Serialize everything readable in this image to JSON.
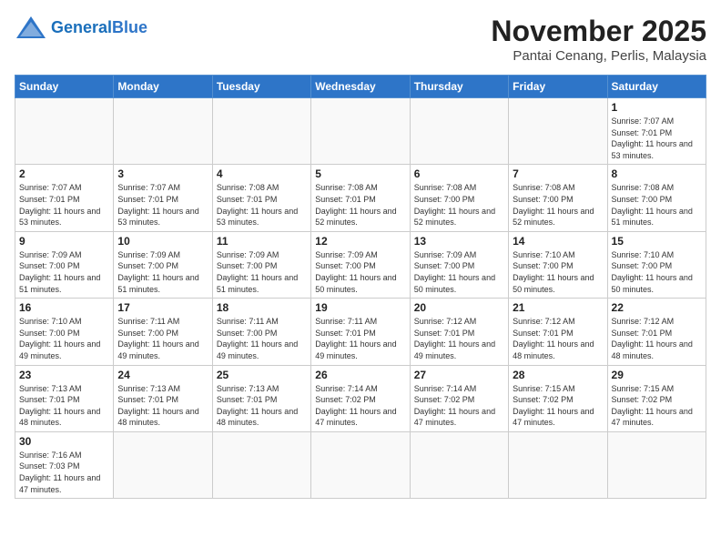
{
  "header": {
    "logo_general": "General",
    "logo_blue": "Blue",
    "month_title": "November 2025",
    "location": "Pantai Cenang, Perlis, Malaysia"
  },
  "weekdays": [
    "Sunday",
    "Monday",
    "Tuesday",
    "Wednesday",
    "Thursday",
    "Friday",
    "Saturday"
  ],
  "weeks": [
    [
      {
        "day": "",
        "sunrise": "",
        "sunset": "",
        "daylight": ""
      },
      {
        "day": "",
        "sunrise": "",
        "sunset": "",
        "daylight": ""
      },
      {
        "day": "",
        "sunrise": "",
        "sunset": "",
        "daylight": ""
      },
      {
        "day": "",
        "sunrise": "",
        "sunset": "",
        "daylight": ""
      },
      {
        "day": "",
        "sunrise": "",
        "sunset": "",
        "daylight": ""
      },
      {
        "day": "",
        "sunrise": "",
        "sunset": "",
        "daylight": ""
      },
      {
        "day": "1",
        "sunrise": "Sunrise: 7:07 AM",
        "sunset": "Sunset: 7:01 PM",
        "daylight": "Daylight: 11 hours and 53 minutes."
      }
    ],
    [
      {
        "day": "2",
        "sunrise": "Sunrise: 7:07 AM",
        "sunset": "Sunset: 7:01 PM",
        "daylight": "Daylight: 11 hours and 53 minutes."
      },
      {
        "day": "3",
        "sunrise": "Sunrise: 7:07 AM",
        "sunset": "Sunset: 7:01 PM",
        "daylight": "Daylight: 11 hours and 53 minutes."
      },
      {
        "day": "4",
        "sunrise": "Sunrise: 7:08 AM",
        "sunset": "Sunset: 7:01 PM",
        "daylight": "Daylight: 11 hours and 53 minutes."
      },
      {
        "day": "5",
        "sunrise": "Sunrise: 7:08 AM",
        "sunset": "Sunset: 7:01 PM",
        "daylight": "Daylight: 11 hours and 52 minutes."
      },
      {
        "day": "6",
        "sunrise": "Sunrise: 7:08 AM",
        "sunset": "Sunset: 7:00 PM",
        "daylight": "Daylight: 11 hours and 52 minutes."
      },
      {
        "day": "7",
        "sunrise": "Sunrise: 7:08 AM",
        "sunset": "Sunset: 7:00 PM",
        "daylight": "Daylight: 11 hours and 52 minutes."
      },
      {
        "day": "8",
        "sunrise": "Sunrise: 7:08 AM",
        "sunset": "Sunset: 7:00 PM",
        "daylight": "Daylight: 11 hours and 51 minutes."
      }
    ],
    [
      {
        "day": "9",
        "sunrise": "Sunrise: 7:09 AM",
        "sunset": "Sunset: 7:00 PM",
        "daylight": "Daylight: 11 hours and 51 minutes."
      },
      {
        "day": "10",
        "sunrise": "Sunrise: 7:09 AM",
        "sunset": "Sunset: 7:00 PM",
        "daylight": "Daylight: 11 hours and 51 minutes."
      },
      {
        "day": "11",
        "sunrise": "Sunrise: 7:09 AM",
        "sunset": "Sunset: 7:00 PM",
        "daylight": "Daylight: 11 hours and 51 minutes."
      },
      {
        "day": "12",
        "sunrise": "Sunrise: 7:09 AM",
        "sunset": "Sunset: 7:00 PM",
        "daylight": "Daylight: 11 hours and 50 minutes."
      },
      {
        "day": "13",
        "sunrise": "Sunrise: 7:09 AM",
        "sunset": "Sunset: 7:00 PM",
        "daylight": "Daylight: 11 hours and 50 minutes."
      },
      {
        "day": "14",
        "sunrise": "Sunrise: 7:10 AM",
        "sunset": "Sunset: 7:00 PM",
        "daylight": "Daylight: 11 hours and 50 minutes."
      },
      {
        "day": "15",
        "sunrise": "Sunrise: 7:10 AM",
        "sunset": "Sunset: 7:00 PM",
        "daylight": "Daylight: 11 hours and 50 minutes."
      }
    ],
    [
      {
        "day": "16",
        "sunrise": "Sunrise: 7:10 AM",
        "sunset": "Sunset: 7:00 PM",
        "daylight": "Daylight: 11 hours and 49 minutes."
      },
      {
        "day": "17",
        "sunrise": "Sunrise: 7:11 AM",
        "sunset": "Sunset: 7:00 PM",
        "daylight": "Daylight: 11 hours and 49 minutes."
      },
      {
        "day": "18",
        "sunrise": "Sunrise: 7:11 AM",
        "sunset": "Sunset: 7:00 PM",
        "daylight": "Daylight: 11 hours and 49 minutes."
      },
      {
        "day": "19",
        "sunrise": "Sunrise: 7:11 AM",
        "sunset": "Sunset: 7:01 PM",
        "daylight": "Daylight: 11 hours and 49 minutes."
      },
      {
        "day": "20",
        "sunrise": "Sunrise: 7:12 AM",
        "sunset": "Sunset: 7:01 PM",
        "daylight": "Daylight: 11 hours and 49 minutes."
      },
      {
        "day": "21",
        "sunrise": "Sunrise: 7:12 AM",
        "sunset": "Sunset: 7:01 PM",
        "daylight": "Daylight: 11 hours and 48 minutes."
      },
      {
        "day": "22",
        "sunrise": "Sunrise: 7:12 AM",
        "sunset": "Sunset: 7:01 PM",
        "daylight": "Daylight: 11 hours and 48 minutes."
      }
    ],
    [
      {
        "day": "23",
        "sunrise": "Sunrise: 7:13 AM",
        "sunset": "Sunset: 7:01 PM",
        "daylight": "Daylight: 11 hours and 48 minutes."
      },
      {
        "day": "24",
        "sunrise": "Sunrise: 7:13 AM",
        "sunset": "Sunset: 7:01 PM",
        "daylight": "Daylight: 11 hours and 48 minutes."
      },
      {
        "day": "25",
        "sunrise": "Sunrise: 7:13 AM",
        "sunset": "Sunset: 7:01 PM",
        "daylight": "Daylight: 11 hours and 48 minutes."
      },
      {
        "day": "26",
        "sunrise": "Sunrise: 7:14 AM",
        "sunset": "Sunset: 7:02 PM",
        "daylight": "Daylight: 11 hours and 47 minutes."
      },
      {
        "day": "27",
        "sunrise": "Sunrise: 7:14 AM",
        "sunset": "Sunset: 7:02 PM",
        "daylight": "Daylight: 11 hours and 47 minutes."
      },
      {
        "day": "28",
        "sunrise": "Sunrise: 7:15 AM",
        "sunset": "Sunset: 7:02 PM",
        "daylight": "Daylight: 11 hours and 47 minutes."
      },
      {
        "day": "29",
        "sunrise": "Sunrise: 7:15 AM",
        "sunset": "Sunset: 7:02 PM",
        "daylight": "Daylight: 11 hours and 47 minutes."
      }
    ],
    [
      {
        "day": "30",
        "sunrise": "Sunrise: 7:16 AM",
        "sunset": "Sunset: 7:03 PM",
        "daylight": "Daylight: 11 hours and 47 minutes."
      },
      {
        "day": "",
        "sunrise": "",
        "sunset": "",
        "daylight": ""
      },
      {
        "day": "",
        "sunrise": "",
        "sunset": "",
        "daylight": ""
      },
      {
        "day": "",
        "sunrise": "",
        "sunset": "",
        "daylight": ""
      },
      {
        "day": "",
        "sunrise": "",
        "sunset": "",
        "daylight": ""
      },
      {
        "day": "",
        "sunrise": "",
        "sunset": "",
        "daylight": ""
      },
      {
        "day": "",
        "sunrise": "",
        "sunset": "",
        "daylight": ""
      }
    ]
  ]
}
